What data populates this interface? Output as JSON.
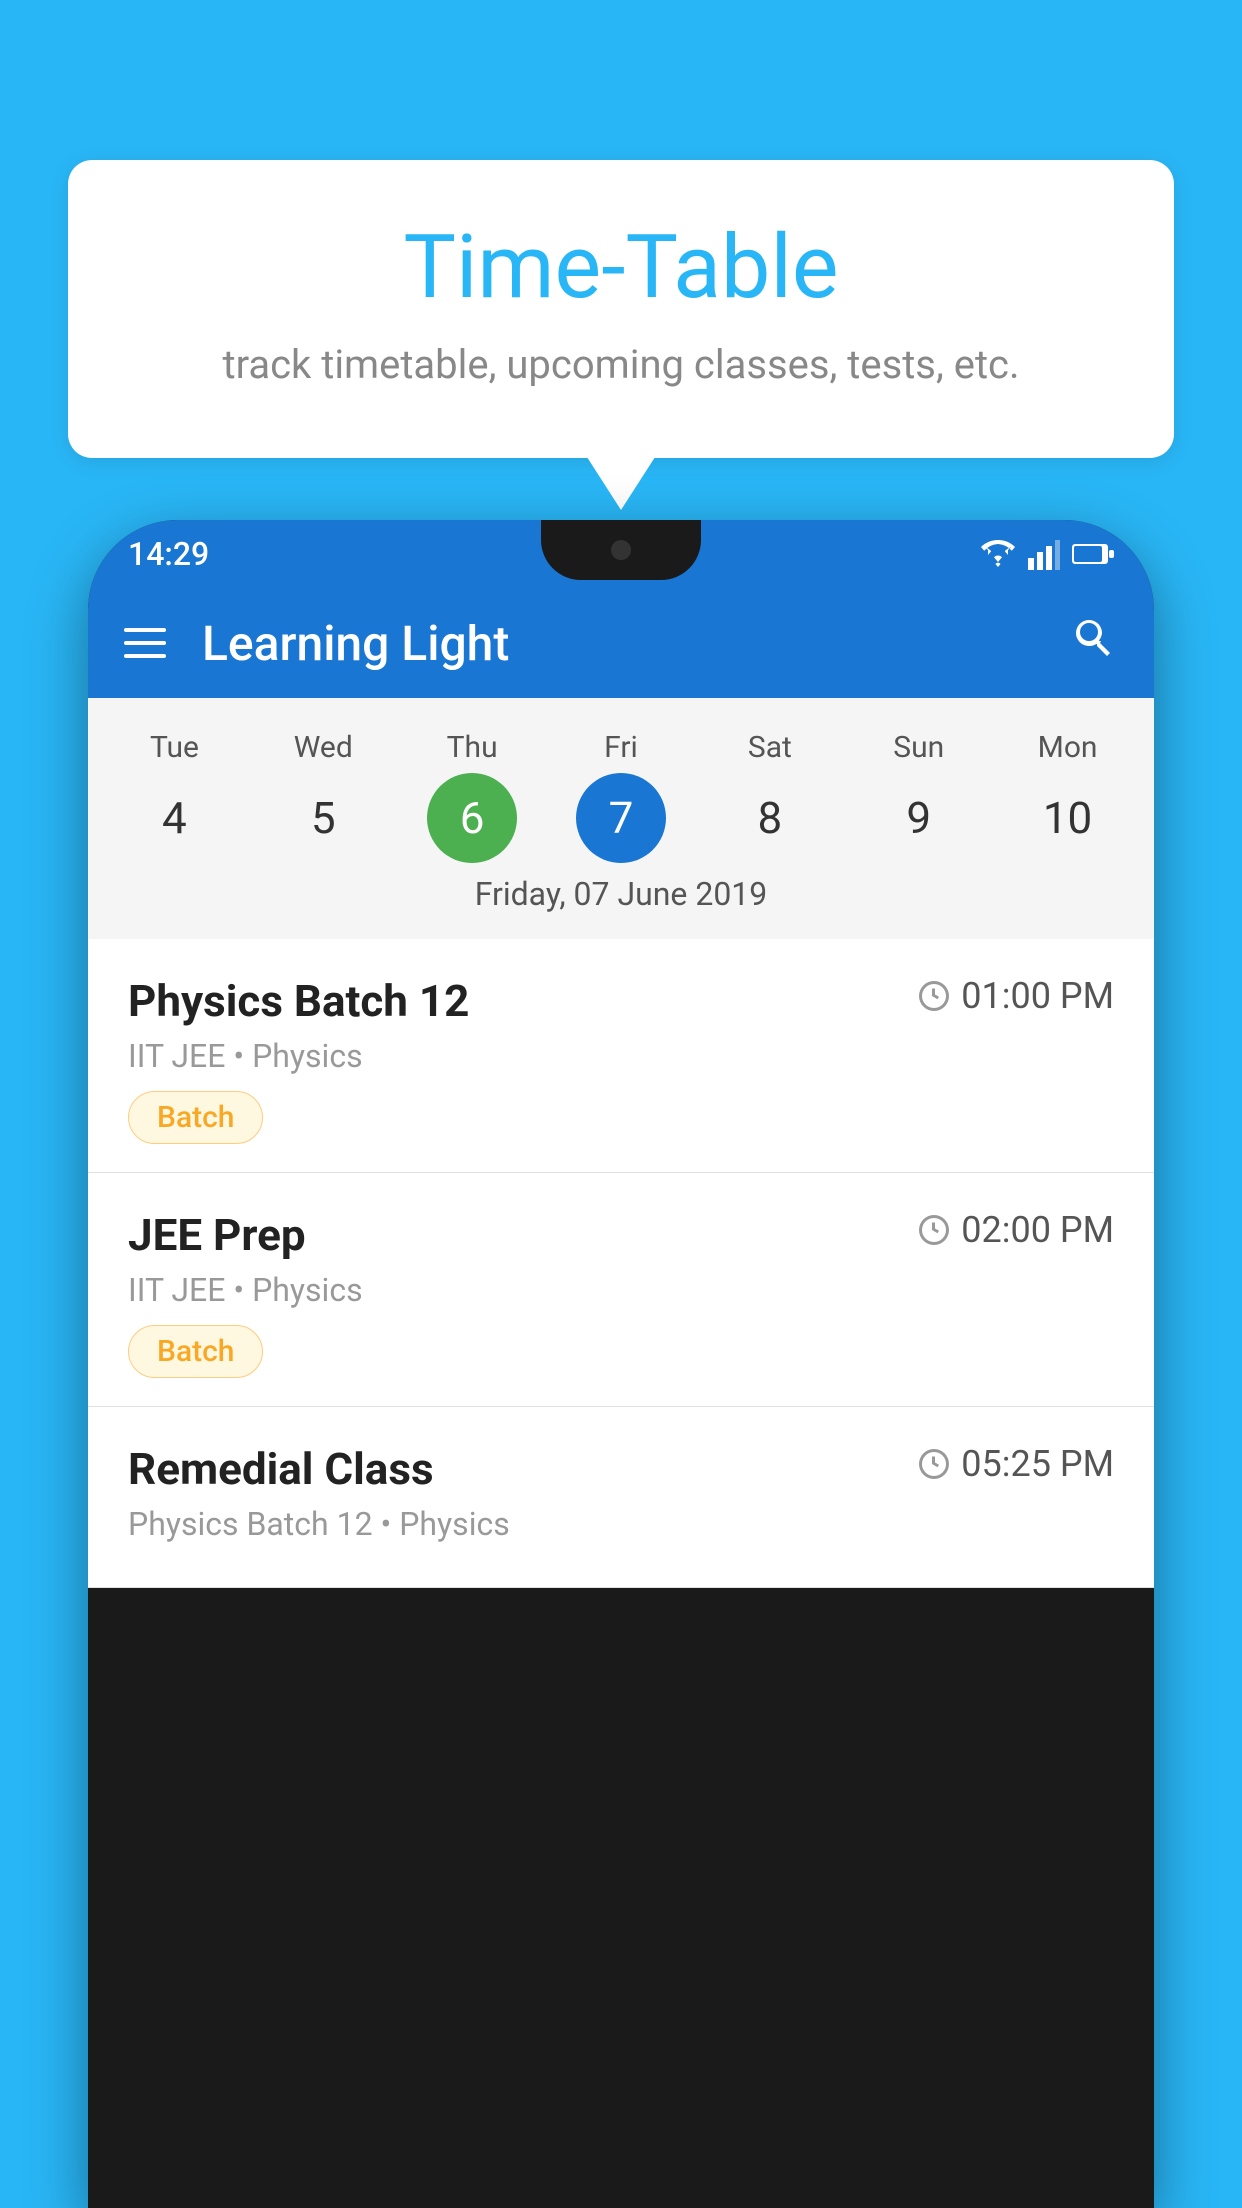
{
  "background_color": "#29B6F6",
  "tooltip": {
    "title": "Time-Table",
    "subtitle": "track timetable, upcoming classes, tests, etc."
  },
  "phone": {
    "status_bar": {
      "time": "14:29",
      "icons": [
        "wifi",
        "signal",
        "battery"
      ]
    },
    "app_bar": {
      "title": "Learning Light",
      "menu_label": "menu",
      "search_label": "search"
    },
    "calendar": {
      "days": [
        {
          "name": "Tue",
          "num": "4",
          "state": "normal"
        },
        {
          "name": "Wed",
          "num": "5",
          "state": "normal"
        },
        {
          "name": "Thu",
          "num": "6",
          "state": "today"
        },
        {
          "name": "Fri",
          "num": "7",
          "state": "selected"
        },
        {
          "name": "Sat",
          "num": "8",
          "state": "normal"
        },
        {
          "name": "Sun",
          "num": "9",
          "state": "normal"
        },
        {
          "name": "Mon",
          "num": "10",
          "state": "normal"
        }
      ],
      "selected_date_label": "Friday, 07 June 2019"
    },
    "classes": [
      {
        "name": "Physics Batch 12",
        "time": "01:00 PM",
        "meta": "IIT JEE • Physics",
        "badge": "Batch"
      },
      {
        "name": "JEE Prep",
        "time": "02:00 PM",
        "meta": "IIT JEE • Physics",
        "badge": "Batch"
      },
      {
        "name": "Remedial Class",
        "time": "05:25 PM",
        "meta": "Physics Batch 12 • Physics",
        "badge": null
      }
    ]
  }
}
